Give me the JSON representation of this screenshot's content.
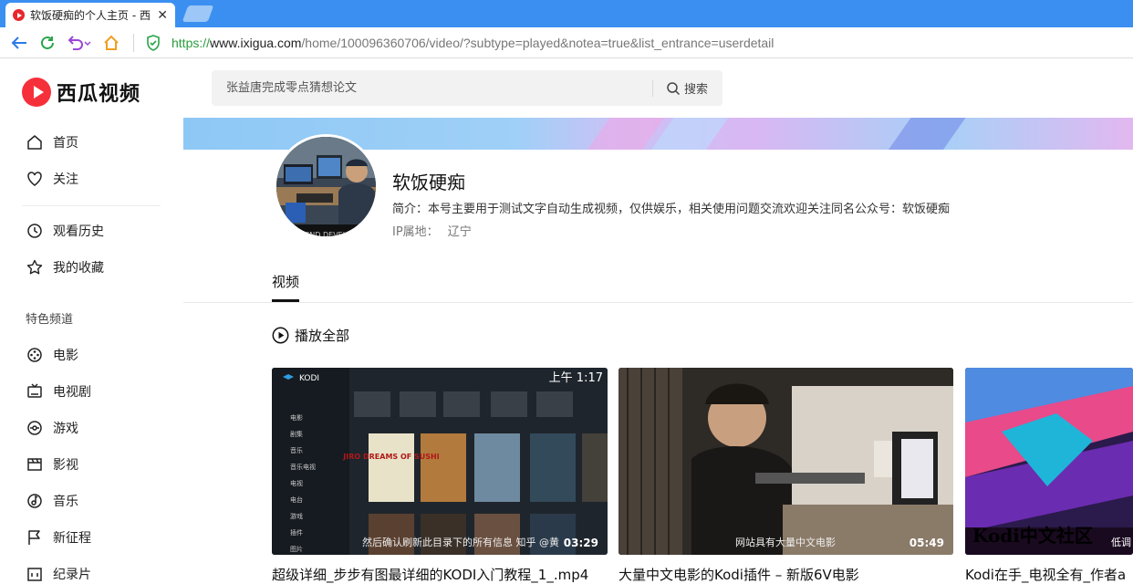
{
  "browser": {
    "tab_title": "软饭硬痴的个人主页 - 西",
    "url_scheme": "https://",
    "url_host": "www.ixigua.com",
    "url_path": "/home/100096360706/video/?subtype=played&notea=true&list_entrance=userdetail"
  },
  "sidebar": {
    "logo_text": "西瓜视频",
    "items_top": [
      {
        "label": "首页",
        "icon": "home-icon"
      },
      {
        "label": "关注",
        "icon": "heart-icon"
      }
    ],
    "items_mid": [
      {
        "label": "观看历史",
        "icon": "clock-icon"
      },
      {
        "label": "我的收藏",
        "icon": "star-icon"
      }
    ],
    "section_title": "特色频道",
    "channels": [
      {
        "label": "电影",
        "icon": "film-reel-icon"
      },
      {
        "label": "电视剧",
        "icon": "tv-icon"
      },
      {
        "label": "游戏",
        "icon": "gamepad-icon"
      },
      {
        "label": "影视",
        "icon": "clapper-icon"
      },
      {
        "label": "音乐",
        "icon": "music-icon"
      },
      {
        "label": "新征程",
        "icon": "flag-icon"
      },
      {
        "label": "纪录片",
        "icon": "documentary-icon"
      }
    ]
  },
  "search": {
    "placeholder": "张益唐完成零点猜想论文",
    "button_label": "搜索"
  },
  "profile": {
    "name": "软饭硬痴",
    "bio": "简介：本号主要用于测试文字自动生成视频，仅供娱乐，相关使用问题交流欢迎关注同名公众号：软饭硬痴",
    "ip_label": "IP属地：",
    "ip_value": "辽宁",
    "avatar_caption": "KEND DEVELOP"
  },
  "tabs": {
    "video": "视频"
  },
  "play_all": "播放全部",
  "videos": [
    {
      "title": "超级详细_步步有图最详细的KODI入门教程_1_.mp4",
      "duration": "03:29",
      "caption": "然后确认刷新此目录下的所有信息 知乎 @黄",
      "kodi_label": "KODI",
      "kodi_time": "上午 1:17",
      "kodi_menu": [
        "电影",
        "剧集",
        "音乐",
        "音乐电视",
        "电视",
        "电台",
        "游戏",
        "插件",
        "图片"
      ],
      "poster_label": "JIRO DREAMS OF SUSHI"
    },
    {
      "title": "大量中文电影的Kodi插件 – 新版6V电影",
      "duration": "05:49",
      "caption": "网站具有大量中文电影"
    },
    {
      "title": "Kodi在手_电视全有_作者a",
      "duration": "",
      "caption": "低调",
      "overlay": "Kodi中文社区"
    }
  ],
  "colors": {
    "tabbar": "#3b8ff0",
    "brand_red": "#f6303a"
  }
}
